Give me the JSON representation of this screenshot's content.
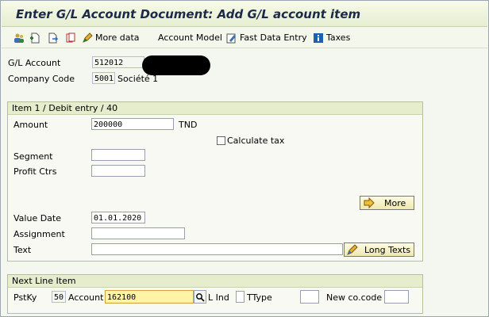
{
  "window": {
    "title": "Enter G/L Account Document: Add G/L account item"
  },
  "toolbar": {
    "more_data": "More data",
    "account_model": "Account Model",
    "fast_data_entry": "Fast Data Entry",
    "taxes": "Taxes"
  },
  "header": {
    "gl_account_label": "G/L Account",
    "gl_account_value": "512012",
    "company_code_label": "Company Code",
    "company_code_value": "5001",
    "company_name": "Société 1"
  },
  "item": {
    "group_title": "Item 1 / Debit entry / 40",
    "amount_label": "Amount",
    "amount_value": "200000",
    "currency": "TND",
    "calculate_tax_label": "Calculate tax",
    "segment_label": "Segment",
    "segment_value": "",
    "profit_ctr_label": "Profit Ctrs",
    "profit_ctr_value": "",
    "more_button": "More",
    "value_date_label": "Value Date",
    "value_date_value": "01.01.2020",
    "assignment_label": "Assignment",
    "assignment_value": "",
    "text_label": "Text",
    "text_value": "",
    "long_texts_button": "Long Texts"
  },
  "next_line": {
    "group_title": "Next Line Item",
    "pstky_label": "PstKy",
    "pstky_value": "50",
    "account_label": "Account",
    "account_value": "162100",
    "l_ind_label": "L Ind",
    "l_ind_value": "",
    "ttype_label": "TType",
    "ttype_value": "",
    "new_cocode_label": "New co.code",
    "new_cocode_value": ""
  }
}
